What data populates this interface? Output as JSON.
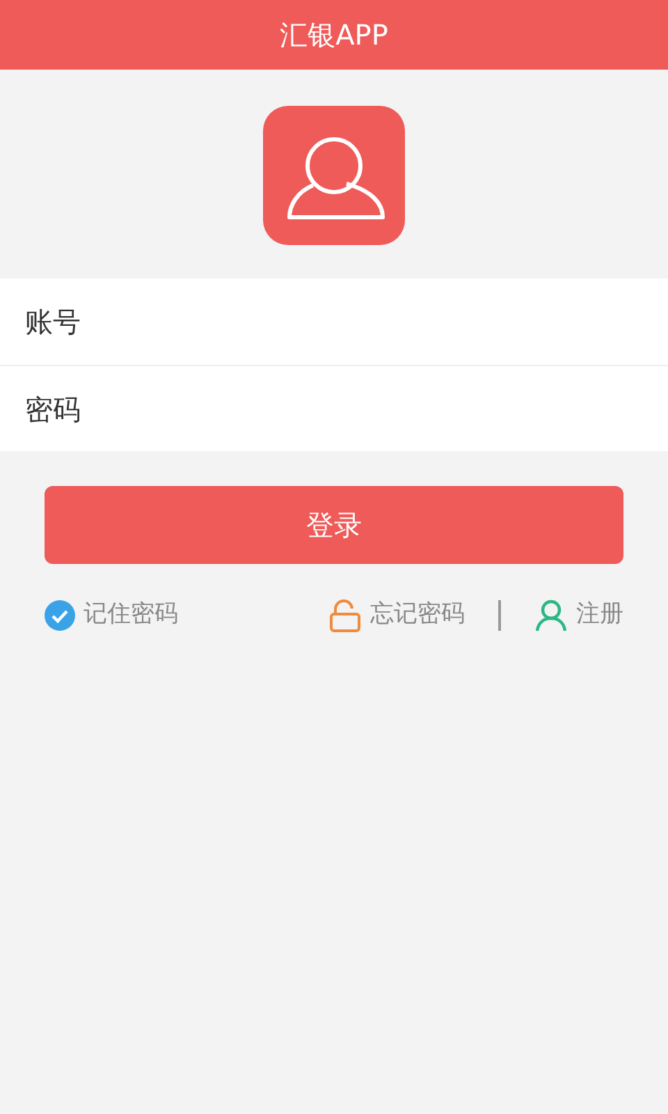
{
  "title_bar": {
    "title": "汇银APP"
  },
  "fields": [
    {
      "placeholder": "账号"
    },
    {
      "placeholder": "密码"
    }
  ],
  "login_button": {
    "label": "登录"
  },
  "remember": {
    "label": "记住密码",
    "checked": true
  },
  "links": [
    {
      "kind": "forgot",
      "label": "忘记密码"
    },
    {
      "kind": "register",
      "label": "注册"
    }
  ]
}
